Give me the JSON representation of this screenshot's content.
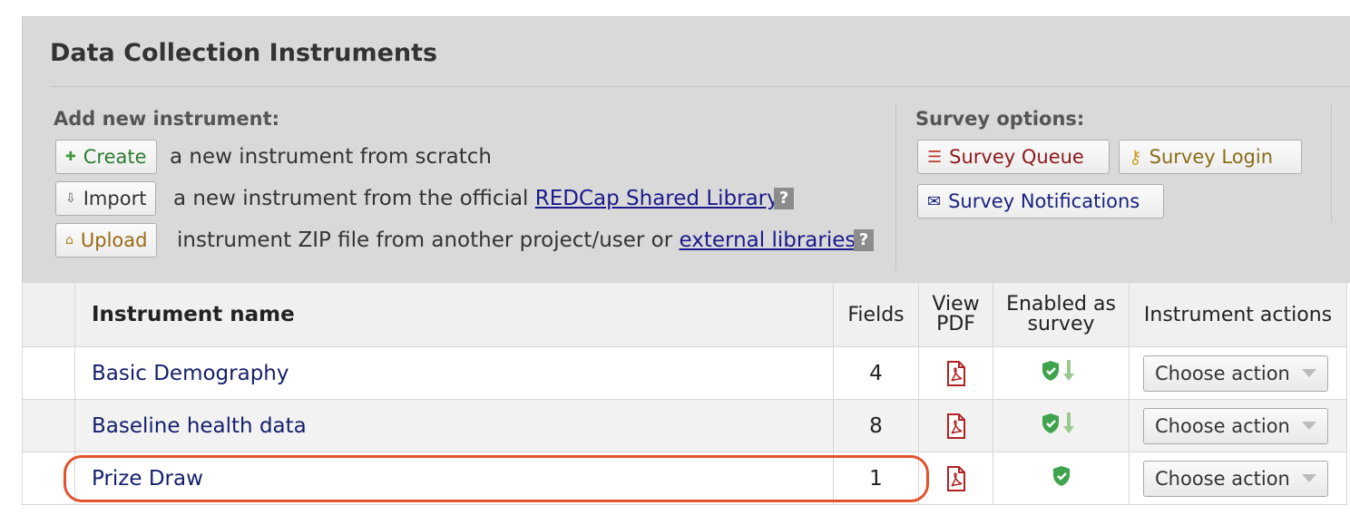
{
  "header": {
    "title": "Data Collection Instruments"
  },
  "add_new": {
    "label": "Add new instrument:",
    "create": {
      "label": "Create",
      "desc": "a new instrument from scratch"
    },
    "import": {
      "label": "Import",
      "desc_pre": "a new instrument from the official ",
      "link": "REDCap Shared Library"
    },
    "upload": {
      "label": "Upload",
      "desc_pre": "instrument ZIP file from another project/user or ",
      "link": "external libraries"
    },
    "help": "?"
  },
  "survey_options": {
    "label": "Survey options:",
    "queue": "Survey Queue",
    "login": "Survey Login",
    "notifications": "Survey Notifications"
  },
  "table": {
    "headers": {
      "name": "Instrument name",
      "fields": "Fields",
      "view_pdf_1": "View",
      "view_pdf_2": "PDF",
      "enabled_1": "Enabled as",
      "enabled_2": "survey",
      "actions": "Instrument actions"
    },
    "rows": [
      {
        "name": "Basic Demography",
        "fields": "4",
        "action": "Choose action"
      },
      {
        "name": "Baseline health data",
        "fields": "8",
        "action": "Choose action"
      },
      {
        "name": "Prize Draw",
        "fields": "1",
        "action": "Choose action"
      }
    ]
  },
  "colors": {
    "accent_red": "#e2532d",
    "link": "#1a1a8c",
    "green": "#3fa34d",
    "pdf_red": "#b22222"
  }
}
